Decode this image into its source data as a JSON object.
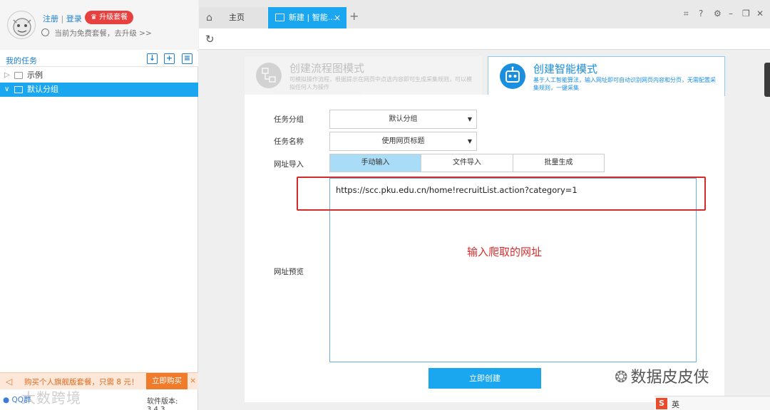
{
  "sidebar": {
    "register": "注册",
    "separator": "|",
    "login": "登录",
    "upgrade_badge": "升级套餐",
    "plan_text": "当前为免费套餐，去升级 >>",
    "my_tasks": "我的任务",
    "tree": [
      {
        "label": "示例",
        "expanded": false,
        "selected": false
      },
      {
        "label": "默认分组",
        "expanded": true,
        "selected": true
      }
    ],
    "promo_text": "购买个人旗舰版套餐，只需 8 元！",
    "promo_buy": "立即购买",
    "promo_close": "×",
    "qq_label": "QQ群",
    "version": "软件版本: 3.4.3",
    "watermark": "大数跨境"
  },
  "tabs": {
    "home": "主页",
    "active": "新建 | 智能...",
    "close": "×",
    "add": "+"
  },
  "modes": {
    "flow": {
      "title": "创建流程图模式",
      "desc": "可模拟操作流程，根据提示在网页中点选内容即可生成采集规则，可以模拟任何人为操作"
    },
    "smart": {
      "title": "创建智能模式",
      "desc": "基于人工智能算法，输入网址即可自动识别网页内容和分页，无需配置采集规则，一键采集"
    }
  },
  "form": {
    "group_label": "任务分组",
    "group_value": "默认分组",
    "name_label": "任务名称",
    "name_value": "使用网页标题",
    "url_import_label": "网址导入",
    "import_tabs": [
      "手动输入",
      "文件导入",
      "批量生成"
    ],
    "url_preview_label": "网址预览",
    "url_value": "https://scc.pku.edu.cn/home!recruitList.action?category=1",
    "annotation": "输入爬取的网址",
    "create_button": "立即创建"
  },
  "overlay": {
    "wechat_watermark": "数据皮皮侠",
    "ime_logo": "S",
    "ime_lang": "英"
  },
  "colors": {
    "accent": "#1ba7f0",
    "annotation_red": "#d42a2a",
    "promo_orange": "#f07b2a"
  }
}
